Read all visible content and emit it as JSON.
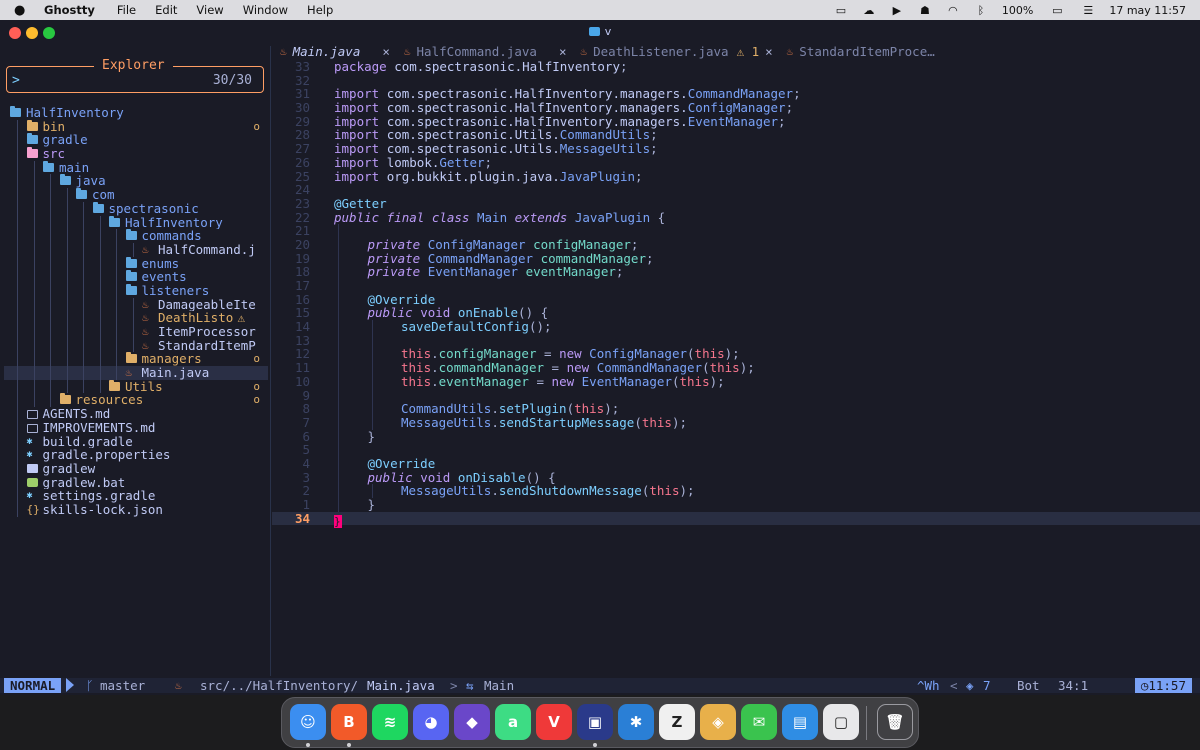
{
  "menubar": {
    "app": "Ghostty",
    "items": [
      "File",
      "Edit",
      "View",
      "Window",
      "Help"
    ],
    "battery": "100%",
    "datetime": "17 may 11:57"
  },
  "window": {
    "title": "v",
    "traffic_colors": {
      "close": "#ff5f57",
      "minimize": "#febc2e",
      "zoom": "#28c840"
    }
  },
  "explorer": {
    "title": "Explorer",
    "prompt": ">",
    "count": "30/30",
    "tree": [
      {
        "label": "HalfInventory",
        "type": "folder-open",
        "depth": 0,
        "color": "#7aa2f7"
      },
      {
        "label": "bin",
        "type": "folder",
        "depth": 1,
        "color": "#e0af68",
        "badge": "o"
      },
      {
        "label": "gradle",
        "type": "folder",
        "depth": 1,
        "color": "#7aa2f7"
      },
      {
        "label": "src",
        "type": "folder-open",
        "depth": 1,
        "color": "#bb9af7"
      },
      {
        "label": "main",
        "type": "folder-open",
        "depth": 2,
        "color": "#7aa2f7"
      },
      {
        "label": "java",
        "type": "folder-open",
        "depth": 3,
        "color": "#7aa2f7"
      },
      {
        "label": "com",
        "type": "folder-open",
        "depth": 4,
        "color": "#7aa2f7"
      },
      {
        "label": "spectrasonic",
        "type": "folder-open",
        "depth": 5,
        "color": "#7aa2f7"
      },
      {
        "label": "HalfInventory",
        "type": "folder-open",
        "depth": 6,
        "color": "#7aa2f7"
      },
      {
        "label": "commands",
        "type": "folder-open",
        "depth": 7,
        "color": "#7aa2f7"
      },
      {
        "label": "HalfCommand.j",
        "type": "java",
        "depth": 8,
        "color": "#c0caf5"
      },
      {
        "label": "enums",
        "type": "folder",
        "depth": 7,
        "color": "#7aa2f7"
      },
      {
        "label": "events",
        "type": "folder",
        "depth": 7,
        "color": "#7aa2f7"
      },
      {
        "label": "listeners",
        "type": "folder-open",
        "depth": 7,
        "color": "#7aa2f7"
      },
      {
        "label": "DamageableIte",
        "type": "java",
        "depth": 8,
        "color": "#c0caf5"
      },
      {
        "label": "DeathListo",
        "type": "java",
        "depth": 8,
        "color": "#e0af68",
        "warn": "⚠"
      },
      {
        "label": "ItemProcessor",
        "type": "java",
        "depth": 8,
        "color": "#c0caf5"
      },
      {
        "label": "StandardItemP",
        "type": "java",
        "depth": 8,
        "color": "#c0caf5"
      },
      {
        "label": "managers",
        "type": "folder",
        "depth": 7,
        "color": "#e0af68",
        "badge": "o"
      },
      {
        "label": "Main.java",
        "type": "java",
        "depth": 7,
        "color": "#c0caf5",
        "selected": true
      },
      {
        "label": "Utils",
        "type": "folder",
        "depth": 6,
        "color": "#e0af68",
        "badge": "o"
      },
      {
        "label": "resources",
        "type": "folder",
        "depth": 3,
        "color": "#e0af68",
        "badge": "o"
      },
      {
        "label": "AGENTS.md",
        "type": "md",
        "depth": 1,
        "color": "#c0caf5"
      },
      {
        "label": "IMPROVEMENTS.md",
        "type": "md",
        "depth": 1,
        "color": "#c0caf5"
      },
      {
        "label": "build.gradle",
        "type": "gradle",
        "depth": 1,
        "color": "#c0caf5"
      },
      {
        "label": "gradle.properties",
        "type": "gradle",
        "depth": 1,
        "color": "#c0caf5"
      },
      {
        "label": "gradlew",
        "type": "plain",
        "depth": 1,
        "color": "#c0caf5"
      },
      {
        "label": "gradlew.bat",
        "type": "bat",
        "depth": 1,
        "color": "#c0caf5"
      },
      {
        "label": "settings.gradle",
        "type": "gradle",
        "depth": 1,
        "color": "#c0caf5"
      },
      {
        "label": "skills-lock.json",
        "type": "json",
        "depth": 1,
        "color": "#c0caf5"
      }
    ]
  },
  "tabs": [
    {
      "label": "Main.java",
      "active": true,
      "close": "×"
    },
    {
      "label": "HalfCommand.java",
      "active": false,
      "close": "×"
    },
    {
      "label": "DeathListener.java",
      "active": false,
      "warn": "⚠ 1",
      "close": "×"
    },
    {
      "label": "StandardItemProce…",
      "active": false
    }
  ],
  "editor": {
    "lines": [
      {
        "n": "33",
        "indent": 0,
        "t": [
          [
            "kw2",
            "package "
          ],
          [
            "pl",
            "com.spectrasonic.HalfInventory"
          ],
          [
            "pu",
            ";"
          ]
        ]
      },
      {
        "n": "32",
        "indent": 0,
        "t": []
      },
      {
        "n": "31",
        "indent": 0,
        "t": [
          [
            "kw2",
            "import "
          ],
          [
            "pl",
            "com.spectrasonic.HalfInventory.managers."
          ],
          [
            "ty",
            "CommandManager"
          ],
          [
            "pu",
            ";"
          ]
        ]
      },
      {
        "n": "30",
        "indent": 0,
        "t": [
          [
            "kw2",
            "import "
          ],
          [
            "pl",
            "com.spectrasonic.HalfInventory.managers."
          ],
          [
            "ty",
            "ConfigManager"
          ],
          [
            "pu",
            ";"
          ]
        ]
      },
      {
        "n": "29",
        "indent": 0,
        "t": [
          [
            "kw2",
            "import "
          ],
          [
            "pl",
            "com.spectrasonic.HalfInventory.managers."
          ],
          [
            "ty",
            "EventManager"
          ],
          [
            "pu",
            ";"
          ]
        ]
      },
      {
        "n": "28",
        "indent": 0,
        "t": [
          [
            "kw2",
            "import "
          ],
          [
            "pl",
            "com.spectrasonic.Utils."
          ],
          [
            "ty",
            "CommandUtils"
          ],
          [
            "pu",
            ";"
          ]
        ]
      },
      {
        "n": "27",
        "indent": 0,
        "t": [
          [
            "kw2",
            "import "
          ],
          [
            "pl",
            "com.spectrasonic.Utils."
          ],
          [
            "ty",
            "MessageUtils"
          ],
          [
            "pu",
            ";"
          ]
        ]
      },
      {
        "n": "26",
        "indent": 0,
        "t": [
          [
            "kw2",
            "import "
          ],
          [
            "pl",
            "lombok."
          ],
          [
            "ty",
            "Getter"
          ],
          [
            "pu",
            ";"
          ]
        ]
      },
      {
        "n": "25",
        "indent": 0,
        "t": [
          [
            "kw2",
            "import "
          ],
          [
            "pl",
            "org.bukkit.plugin.java."
          ],
          [
            "ty",
            "JavaPlugin"
          ],
          [
            "pu",
            ";"
          ]
        ]
      },
      {
        "n": "24",
        "indent": 0,
        "t": []
      },
      {
        "n": "23",
        "indent": 0,
        "t": [
          [
            "an",
            "@Getter"
          ]
        ]
      },
      {
        "n": "22",
        "indent": 0,
        "t": [
          [
            "kw",
            "public final class "
          ],
          [
            "ty",
            "Main "
          ],
          [
            "kw",
            "extends "
          ],
          [
            "ty",
            "JavaPlugin "
          ],
          [
            "pu",
            "{"
          ]
        ]
      },
      {
        "n": "21",
        "indent": 1,
        "t": []
      },
      {
        "n": "20",
        "indent": 1,
        "t": [
          [
            "kw",
            "private "
          ],
          [
            "ty",
            "ConfigManager "
          ],
          [
            "pr",
            "configManager"
          ],
          [
            "pu",
            ";"
          ]
        ]
      },
      {
        "n": "19",
        "indent": 1,
        "t": [
          [
            "kw",
            "private "
          ],
          [
            "ty",
            "CommandManager "
          ],
          [
            "pr",
            "commandManager"
          ],
          [
            "pu",
            ";"
          ]
        ]
      },
      {
        "n": "18",
        "indent": 1,
        "t": [
          [
            "kw",
            "private "
          ],
          [
            "ty",
            "EventManager "
          ],
          [
            "pr",
            "eventManager"
          ],
          [
            "pu",
            ";"
          ]
        ]
      },
      {
        "n": "17",
        "indent": 1,
        "t": []
      },
      {
        "n": "16",
        "indent": 1,
        "t": [
          [
            "an",
            "@Override"
          ]
        ]
      },
      {
        "n": "15",
        "indent": 1,
        "t": [
          [
            "kw",
            "public "
          ],
          [
            "kw2",
            "void "
          ],
          [
            "fn",
            "onEnable"
          ],
          [
            "pu",
            "() {"
          ]
        ]
      },
      {
        "n": "14",
        "indent": 2,
        "t": [
          [
            "fn",
            "saveDefaultConfig"
          ],
          [
            "pu",
            "();"
          ]
        ]
      },
      {
        "n": "13",
        "indent": 2,
        "t": []
      },
      {
        "n": "12",
        "indent": 2,
        "t": [
          [
            "th",
            "this"
          ],
          [
            "pu",
            "."
          ],
          [
            "pr",
            "configManager "
          ],
          [
            "pu",
            "= "
          ],
          [
            "kw2",
            "new "
          ],
          [
            "ty",
            "ConfigManager"
          ],
          [
            "pu",
            "("
          ],
          [
            "th",
            "this"
          ],
          [
            "pu",
            ");"
          ]
        ]
      },
      {
        "n": "11",
        "indent": 2,
        "t": [
          [
            "th",
            "this"
          ],
          [
            "pu",
            "."
          ],
          [
            "pr",
            "commandManager "
          ],
          [
            "pu",
            "= "
          ],
          [
            "kw2",
            "new "
          ],
          [
            "ty",
            "CommandManager"
          ],
          [
            "pu",
            "("
          ],
          [
            "th",
            "this"
          ],
          [
            "pu",
            ");"
          ]
        ]
      },
      {
        "n": "10",
        "indent": 2,
        "t": [
          [
            "th",
            "this"
          ],
          [
            "pu",
            "."
          ],
          [
            "pr",
            "eventManager "
          ],
          [
            "pu",
            "= "
          ],
          [
            "kw2",
            "new "
          ],
          [
            "ty",
            "EventManager"
          ],
          [
            "pu",
            "("
          ],
          [
            "th",
            "this"
          ],
          [
            "pu",
            ");"
          ]
        ]
      },
      {
        "n": "9",
        "indent": 2,
        "t": []
      },
      {
        "n": "8",
        "indent": 2,
        "t": [
          [
            "ty",
            "CommandUtils"
          ],
          [
            "pu",
            "."
          ],
          [
            "fn",
            "setPlugin"
          ],
          [
            "pu",
            "("
          ],
          [
            "th",
            "this"
          ],
          [
            "pu",
            ");"
          ]
        ]
      },
      {
        "n": "7",
        "indent": 2,
        "t": [
          [
            "ty",
            "MessageUtils"
          ],
          [
            "pu",
            "."
          ],
          [
            "fn",
            "sendStartupMessage"
          ],
          [
            "pu",
            "("
          ],
          [
            "th",
            "this"
          ],
          [
            "pu",
            ");"
          ]
        ]
      },
      {
        "n": "6",
        "indent": 1,
        "t": [
          [
            "pu",
            "}"
          ]
        ]
      },
      {
        "n": "5",
        "indent": 1,
        "t": []
      },
      {
        "n": "4",
        "indent": 1,
        "t": [
          [
            "an",
            "@Override"
          ]
        ]
      },
      {
        "n": "3",
        "indent": 1,
        "t": [
          [
            "kw",
            "public "
          ],
          [
            "kw2",
            "void "
          ],
          [
            "fn",
            "onDisable"
          ],
          [
            "pu",
            "() {"
          ]
        ]
      },
      {
        "n": "2",
        "indent": 2,
        "t": [
          [
            "ty",
            "MessageUtils"
          ],
          [
            "pu",
            "."
          ],
          [
            "fn",
            "sendShutdownMessage"
          ],
          [
            "pu",
            "("
          ],
          [
            "th",
            "this"
          ],
          [
            "pu",
            ");"
          ]
        ]
      },
      {
        "n": "1",
        "indent": 1,
        "t": [
          [
            "pu",
            "}"
          ]
        ]
      },
      {
        "n": "34",
        "indent": 0,
        "t": [],
        "current": true,
        "cursor": "}"
      }
    ]
  },
  "statusline": {
    "mode": "NORMAL",
    "branch": "master",
    "path_prefix": "src/../HalfInventory/",
    "path_file": "Main.java",
    "symbol": "Main",
    "keys": "^Wh",
    "lsp_count": "7",
    "position_word": "Bot",
    "cursor_pos": "34:1",
    "time": "11:57"
  },
  "dock": {
    "apps": [
      {
        "name": "finder",
        "color": "#3b8ef0",
        "glyph": "☺",
        "running": true
      },
      {
        "name": "brave",
        "color": "#f25a29",
        "glyph": "B",
        "running": true
      },
      {
        "name": "spotify",
        "color": "#1ed760",
        "glyph": "≋",
        "running": false
      },
      {
        "name": "discord",
        "color": "#5865f2",
        "glyph": "◕",
        "running": false
      },
      {
        "name": "obsidian",
        "color": "#6a47c9",
        "glyph": "◆",
        "running": false
      },
      {
        "name": "android-studio",
        "color": "#3ddc84",
        "glyph": "a",
        "running": false
      },
      {
        "name": "vivaldi",
        "color": "#ef3939",
        "glyph": "V",
        "running": false
      },
      {
        "name": "ghostty",
        "color": "#2a3a8a",
        "glyph": "▣",
        "running": true
      },
      {
        "name": "vscode",
        "color": "#2a7fd6",
        "glyph": "✱",
        "running": false
      },
      {
        "name": "zed",
        "color": "#f0f0f0",
        "glyph": "Z",
        "running": false
      },
      {
        "name": "app-cube",
        "color": "#e8b04a",
        "glyph": "◈",
        "running": false
      },
      {
        "name": "line-messenger",
        "color": "#3ac34e",
        "glyph": "✉",
        "running": false
      },
      {
        "name": "reminders",
        "color": "#2f8de4",
        "glyph": "▤",
        "running": false
      },
      {
        "name": "twitch-like",
        "color": "#e8e8ea",
        "glyph": "▢",
        "running": false
      }
    ],
    "trash": "trash"
  }
}
